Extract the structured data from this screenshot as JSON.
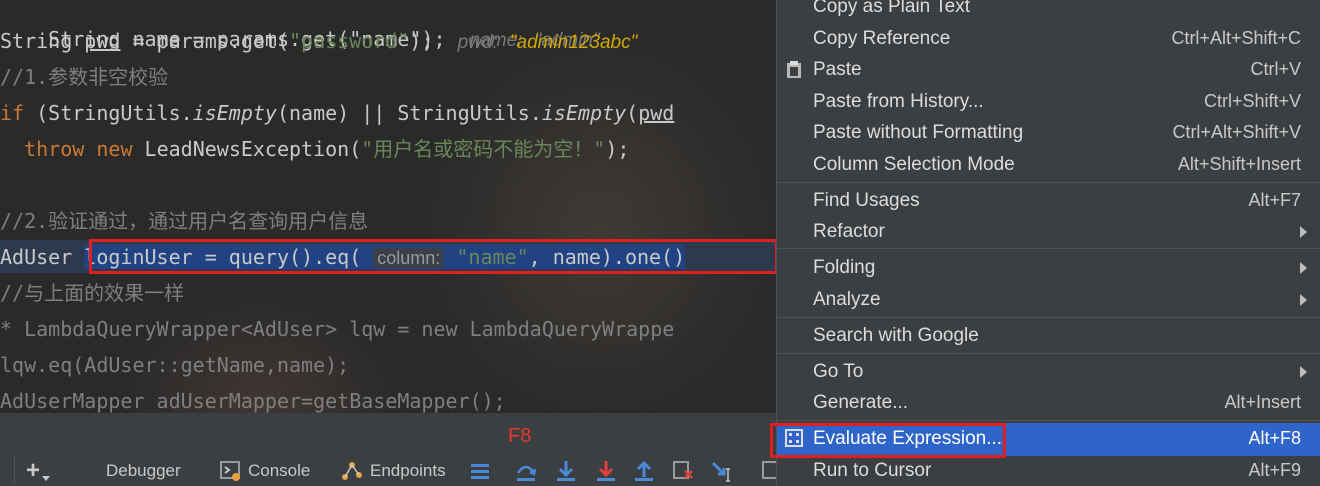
{
  "editor": {
    "line1": {
      "code": "String name = params.get(\"name\");",
      "hint_label": "name:",
      "hint_value": "\"admin\""
    },
    "line2": {
      "pre": "String ",
      "var": "pwd",
      "mid": " = params.get(",
      "str": "\"password\"",
      "end": ");",
      "hint_label": "pwd:",
      "hint_value": "\"admin123abc\""
    },
    "line3": {
      "comment": "//1.参数非空校验"
    },
    "line4": {
      "kw": "if",
      "a": " (StringUtils.",
      "m1": "isEmpty",
      "b": "(name) || StringUtils.",
      "m2": "isEmpty",
      "c": "(",
      "d": "pwd"
    },
    "line5": {
      "kw1": "throw",
      "kw2": "new",
      "cls": " LeadNewsException(",
      "str": "\"用户名或密码不能为空！\"",
      "end": ");"
    },
    "line6": {
      "text": "}"
    },
    "line7": {
      "comment": "//2.验证通过，通过用户名查询用户信息"
    },
    "line8": {
      "type": "AdUser ",
      "a": "loginUser = query().eq( ",
      "hint": "column:",
      "str": "\"name\"",
      "b": ", name).one()"
    },
    "line9": {
      "comment": "//与上面的效果一样"
    },
    "line10": {
      "comment": "* LambdaQueryWrapper<AdUser> lqw = new LambdaQueryWrappe"
    },
    "line11": {
      "comment": "lqw.eq(AdUser::getName,name);"
    },
    "line12": {
      "comment": "AdUserMapper adUserMapper=getBaseMapper();"
    }
  },
  "annotation": {
    "f8": "F8"
  },
  "toolbar": {
    "add_label": "+",
    "debugger": "Debugger",
    "console": "Console",
    "endpoints": "Endpoints"
  },
  "menu": {
    "items": [
      {
        "label": "Copy as Plain Text",
        "shortcut": ""
      },
      {
        "label": "Copy Reference",
        "shortcut": "Ctrl+Alt+Shift+C"
      },
      {
        "label": "Paste",
        "shortcut": "Ctrl+V"
      },
      {
        "label": "Paste from History...",
        "shortcut": "Ctrl+Shift+V"
      },
      {
        "label": "Paste without Formatting",
        "shortcut": "Ctrl+Alt+Shift+V"
      },
      {
        "label": "Column Selection Mode",
        "shortcut": "Alt+Shift+Insert"
      },
      {
        "label": "Find Usages",
        "shortcut": "Alt+F7"
      },
      {
        "label": "Refactor",
        "shortcut": ""
      },
      {
        "label": "Folding",
        "shortcut": ""
      },
      {
        "label": "Analyze",
        "shortcut": ""
      },
      {
        "label": "Search with Google",
        "shortcut": ""
      },
      {
        "label": "Go To",
        "shortcut": ""
      },
      {
        "label": "Generate...",
        "shortcut": "Alt+Insert"
      },
      {
        "label": "Evaluate Expression...",
        "shortcut": "Alt+F8"
      },
      {
        "label": "Run to Cursor",
        "shortcut": "Alt+F9"
      }
    ]
  },
  "colors": {
    "accent": "#2f65ca",
    "annotation_red": "#e02020",
    "string_green": "#6a8759",
    "keyword_orange": "#cc7832"
  }
}
